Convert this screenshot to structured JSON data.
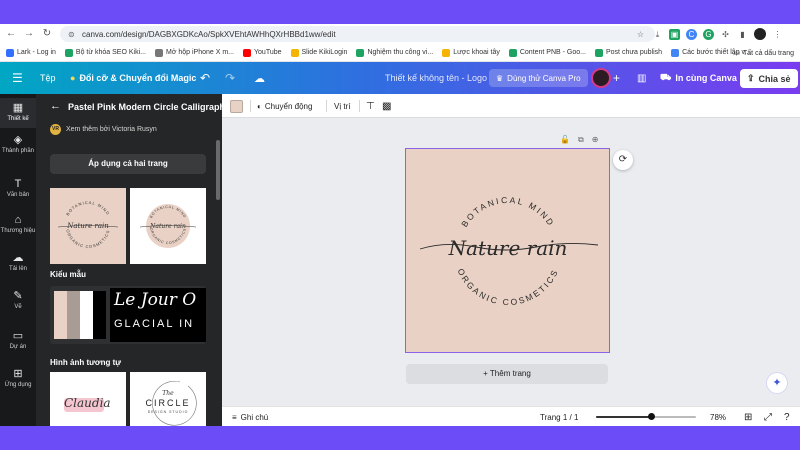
{
  "browser": {
    "url": "canva.com/design/DAGBXGDKcAo/SpkXVEhtAWHhQXrHBBd1ww/edit",
    "bookmarks": [
      {
        "label": "Lark - Log in",
        "color": "#3370ff"
      },
      {
        "label": "Bộ từ khóa SEO Kiki...",
        "color": "#1ea362"
      },
      {
        "label": "Mở hộp iPhone X m...",
        "color": "#777777"
      },
      {
        "label": "YouTube",
        "color": "#ff0000"
      },
      {
        "label": "Slide KikiLogin",
        "color": "#f4b400"
      },
      {
        "label": "Nghiệm thu công vi...",
        "color": "#1ea362"
      },
      {
        "label": "Lược khoai tây",
        "color": "#f4b400"
      },
      {
        "label": "Content PNB - Goo...",
        "color": "#1ea362"
      },
      {
        "label": "Post chưa publish",
        "color": "#1ea362"
      },
      {
        "label": "Các bước thiết lập v...",
        "color": "#4285f4"
      }
    ],
    "all_bookmarks": "Tất cả dấu trang"
  },
  "topbar": {
    "file": "Tệp",
    "magic": "Đổi cỡ & Chuyển đổi Magic",
    "doc_title": "Thiết kế không tên - Logo",
    "try_pro": "Dùng thử Canva Pro",
    "print": "In cùng Canva",
    "share": "Chia sẻ"
  },
  "rail": [
    {
      "label": "Thiết kế",
      "icon": "layout-icon"
    },
    {
      "label": "Thành phần",
      "icon": "shapes-icon"
    },
    {
      "label": "Văn bản",
      "icon": "text-icon"
    },
    {
      "label": "Thương hiệu",
      "icon": "brand-icon"
    },
    {
      "label": "Tải lên",
      "icon": "upload-icon"
    },
    {
      "label": "Vẽ",
      "icon": "draw-icon"
    },
    {
      "label": "Dự án",
      "icon": "folder-icon"
    },
    {
      "label": "Ứng dụng",
      "icon": "apps-icon"
    }
  ],
  "panel": {
    "title": "Pastel Pink Modern Circle Calligraphy ...",
    "by_initials": "VR",
    "by_text": "Xem thêm bởi Victoria Rusyn",
    "apply_button": "Áp dụng cả hai trang",
    "styles_heading": "Kiểu mẫu",
    "similar_heading": "Hình ảnh tương tự",
    "style_font_sample": "Le Jour O",
    "style_font_sample2": "GLACIAL IN",
    "style_palette": [
      "#e9d2c5",
      "#a89c95",
      "#ffffff",
      "#000000"
    ],
    "similar_1": "Claudia",
    "similar_2_top": "The",
    "similar_2_main": "CIRCLE",
    "similar_2_sub": "DESIGN STUDIO"
  },
  "context_bar": {
    "color": "#e8d1c5",
    "animate": "Chuyển động",
    "position": "Vị trí"
  },
  "logo": {
    "top_text": "BOTANICAL MIND",
    "script_text": "Nature rain",
    "bottom_text": "ORGANIC COSMETICS",
    "bg_color": "#e9d2c5"
  },
  "editor": {
    "add_page": "+ Thêm trang"
  },
  "footer": {
    "notes": "Ghi chú",
    "page_indicator": "Trang 1 / 1",
    "zoom": "78%",
    "zoom_fraction": 0.55
  }
}
